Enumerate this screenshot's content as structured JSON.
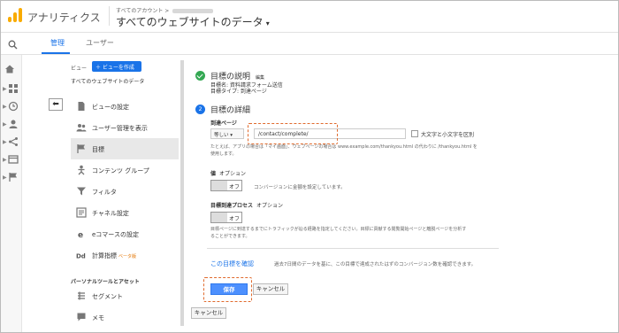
{
  "header": {
    "app_name": "アナリティクス",
    "account_small": "すべてのアカウント > ",
    "property_title": "すべてのウェブサイトのデータ",
    "caret": "▾"
  },
  "tabs": [
    {
      "label": "管理",
      "active": true
    },
    {
      "label": "ユーザー",
      "active": false
    }
  ],
  "admin": {
    "view_label": "ビュー",
    "create_view": "＋ ビューを作成",
    "view_name": "すべてのウェブサイトのデータ",
    "back": "⬅",
    "items": [
      {
        "label": "ビューの設定",
        "icon": "document-icon"
      },
      {
        "label": "ユーザー管理を表示",
        "icon": "users-icon"
      },
      {
        "label": "目標",
        "icon": "flag-icon",
        "active": true
      },
      {
        "label": "コンテンツ グループ",
        "icon": "person-icon"
      },
      {
        "label": "フィルタ",
        "icon": "filter-icon"
      },
      {
        "label": "チャネル設定",
        "icon": "channel-icon"
      },
      {
        "label": "eコマースの設定",
        "icon": "cart-icon"
      },
      {
        "label": "計算指標",
        "icon": "dd-icon",
        "badge": "ベータ版"
      }
    ],
    "section_personal": "パーソナルツールとアセット",
    "personal_items": [
      {
        "label": "セグメント",
        "icon": "segment-icon"
      },
      {
        "label": "メモ",
        "icon": "memo-icon"
      }
    ]
  },
  "goal": {
    "desc_title": "目標の説明",
    "desc_edit": "編集",
    "desc_name": "目標名: 資料請求フォーム送信",
    "desc_type": "目標タイプ: 到達ページ",
    "details_step": "2",
    "details_title": "目標の詳細",
    "dest_label": "到達ページ",
    "match_type": "等しい ▾",
    "dest_value": "/contact/complete/",
    "case_label": "大文字と小文字を区別",
    "dest_note_1": "たとえば、アプリの場合は「マイ画面」、ウェブページの場合は www.example.com/thankyou.html の代わりに /thankyou.html を",
    "dest_note_2": "使用します。",
    "value_label": "値",
    "value_opt": "オプション",
    "value_toggle": "オフ",
    "value_note": "コンバージョンに金額を設定しています。",
    "funnel_label": "目標到達プロセス",
    "funnel_opt": "オプション",
    "funnel_toggle": "オフ",
    "funnel_note_1": "目標ページに到達するまでにトラフィックが辿る経路を指定してください。目標に貢献する閲覧開始ページと離脱ページを分析す",
    "funnel_note_2": "ることができます。",
    "verify_link": "この目標を確認",
    "verify_note": "過去7日間のデータを基に、この目標で達成されたはずのコンバージョン数を確認できます。",
    "save": "保存",
    "cancel": "キャンセル",
    "cancel_outer": "キャンセル"
  },
  "colors": {
    "accent": "#1a73e8",
    "highlight": "#e06b2e",
    "success": "#34a853",
    "logo": "#f9ab00"
  }
}
